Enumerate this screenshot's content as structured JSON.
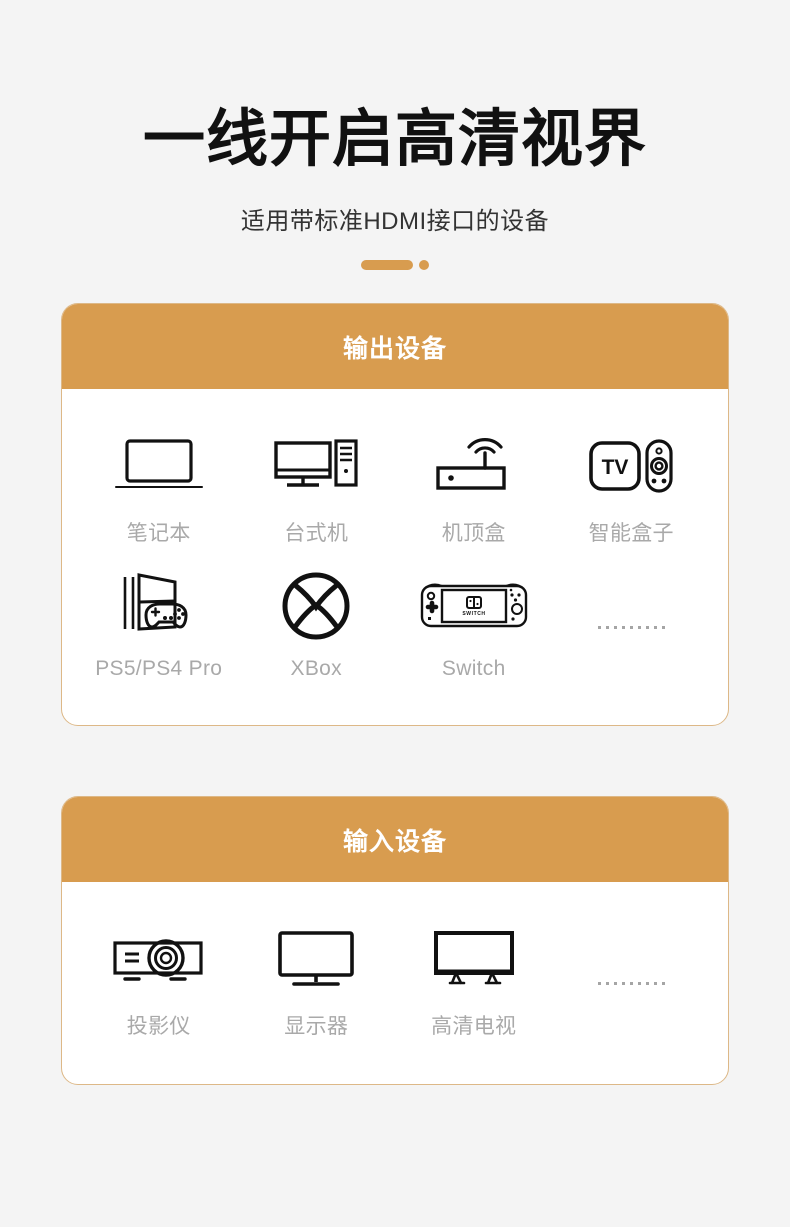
{
  "hero": {
    "title": "一线开启高清视界",
    "subtitle": "适用带标准HDMI接口的设备",
    "accent_color": "#d89c4f"
  },
  "colors": {
    "background": "#f4f4f4",
    "card_border": "#ddb887",
    "card_header_bg": "#d89c4f",
    "card_body_bg": "#ffffff",
    "label_text": "#a9a9a9",
    "icon_stroke": "#111111",
    "title_text": "#111111",
    "subtitle_text": "#333333"
  },
  "cards": [
    {
      "id": "output",
      "header": "输出设备",
      "items": [
        {
          "label": "笔记本",
          "icon": "laptop-icon"
        },
        {
          "label": "台式机",
          "icon": "desktop-tower-icon"
        },
        {
          "label": "机顶盒",
          "icon": "set-top-box-icon"
        },
        {
          "label": "智能盒子",
          "icon": "tv-box-remote-icon"
        },
        {
          "label": "PS5/PS4 Pro",
          "icon": "playstation-console-icon"
        },
        {
          "label": "XBox",
          "icon": "xbox-logo-icon"
        },
        {
          "label": "Switch",
          "icon": "nintendo-switch-icon"
        },
        {
          "label": "",
          "icon": "ellipsis-dots-icon"
        }
      ]
    },
    {
      "id": "input",
      "header": "输入设备",
      "items": [
        {
          "label": "投影仪",
          "icon": "projector-icon"
        },
        {
          "label": "显示器",
          "icon": "monitor-icon"
        },
        {
          "label": "高清电视",
          "icon": "hdtv-icon"
        },
        {
          "label": "",
          "icon": "ellipsis-dots-icon"
        }
      ]
    }
  ]
}
